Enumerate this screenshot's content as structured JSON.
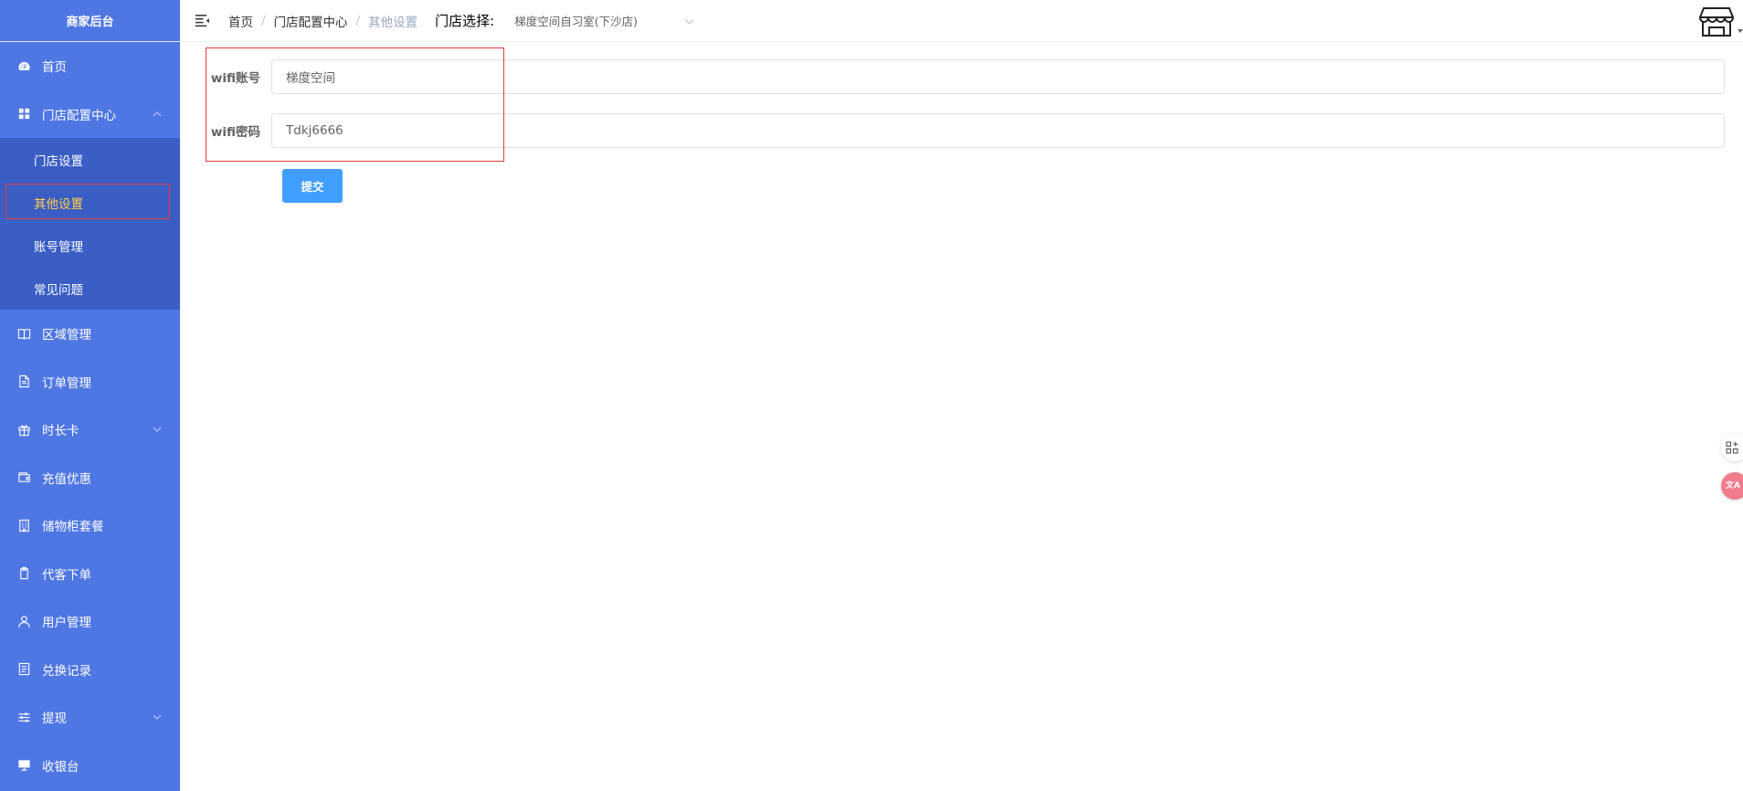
{
  "sidebar": {
    "brand": "商家后台",
    "items": [
      {
        "label": "首页",
        "icon": "dashboard-icon"
      },
      {
        "label": "门店配置中心",
        "icon": "grid-icon",
        "expanded": true,
        "children": [
          {
            "label": "门店设置"
          },
          {
            "label": "其他设置",
            "active": true
          },
          {
            "label": "账号管理"
          },
          {
            "label": "常见问题"
          }
        ]
      },
      {
        "label": "区域管理",
        "icon": "book-icon"
      },
      {
        "label": "订单管理",
        "icon": "document-icon"
      },
      {
        "label": "时长卡",
        "icon": "gift-icon",
        "has_children": true
      },
      {
        "label": "充值优惠",
        "icon": "wallet-icon"
      },
      {
        "label": "储物柜套餐",
        "icon": "building-icon"
      },
      {
        "label": "代客下单",
        "icon": "clipboard-icon"
      },
      {
        "label": "用户管理",
        "icon": "user-icon"
      },
      {
        "label": "兑换记录",
        "icon": "list-icon"
      },
      {
        "label": "提现",
        "icon": "sliders-icon",
        "has_children": true
      },
      {
        "label": "收银台",
        "icon": "monitor-icon"
      }
    ]
  },
  "header": {
    "breadcrumb": [
      "首页",
      "门店配置中心",
      "其他设置"
    ],
    "breadcrumb_sep": "/",
    "store_label": "门店选择:",
    "store_value": "梯度空间自习室(下沙店)"
  },
  "form": {
    "wifi_account_label": "wifi账号",
    "wifi_account_value": "梯度空间",
    "wifi_password_label": "wifi密码",
    "wifi_password_value": "Tdkj6666",
    "submit_label": "提交"
  },
  "floating": {
    "translate_text": "文A"
  },
  "colors": {
    "sidebar_bg": "#4f77e4",
    "submenu_bg": "#3b5ec5",
    "active_text": "#ffd04b",
    "primary": "#409eff",
    "highlight": "#e43b3b"
  }
}
